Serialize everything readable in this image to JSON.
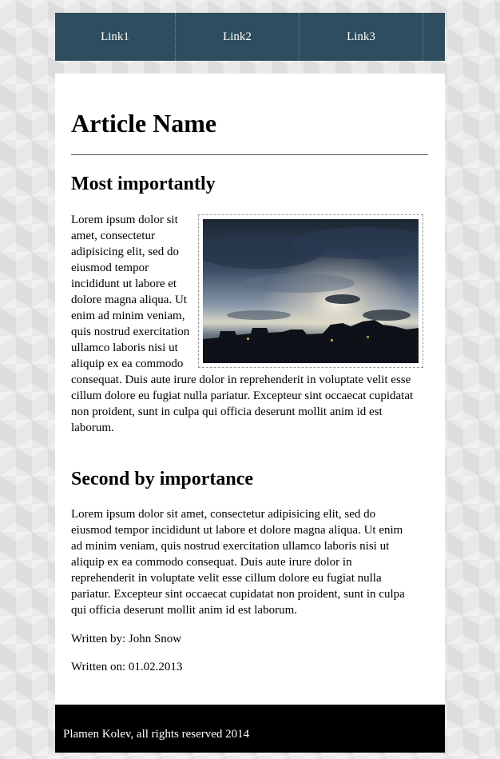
{
  "nav": {
    "items": [
      {
        "label": "Link1"
      },
      {
        "label": "Link2"
      },
      {
        "label": "Link3"
      }
    ]
  },
  "article": {
    "title": "Article Name",
    "sections": [
      {
        "heading": "Most importantly",
        "paragraph": "Lorem ipsum dolor sit amet, consectetur adipisicing elit, sed do eiusmod tempor incididunt ut labore et dolore magna aliqua. Ut enim ad minim veniam, quis nostrud exercitation ullamco laboris nisi ut aliquip ex ea commodo consequat. Duis aute irure dolor in reprehenderit in voluptate velit esse cillum dolore eu fugiat nulla pariatur. Excepteur sint occaecat cupidatat non proident, sunt in culpa qui officia deserunt mollit anim id est laborum."
      },
      {
        "heading": "Second by importance",
        "paragraph": "Lorem ipsum dolor sit amet, consectetur adipisicing elit, sed do eiusmod tempor incididunt ut labore et dolore magna aliqua. Ut enim ad minim veniam, quis nostrud exercitation ullamco laboris nisi ut aliquip ex ea commodo consequat. Duis aute irure dolor in reprehenderit in voluptate velit esse cillum dolore eu fugiat nulla pariatur. Excepteur sint occaecat cupidatat non proident, sunt in culpa qui officia deserunt mollit anim id est laborum."
      }
    ],
    "written_by": "Written by: John Snow",
    "written_on": "Written on: 01.02.2013"
  },
  "footer": {
    "text": "Plamen Kolev, all rights reserved 2014"
  },
  "colors": {
    "nav_background": "#2e4d5f",
    "content_background": "#ffffff",
    "footer_background": "#000000"
  }
}
